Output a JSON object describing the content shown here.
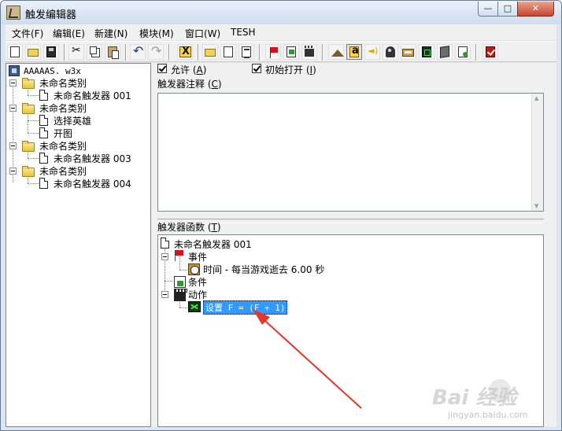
{
  "window": {
    "title": "触发编辑器",
    "controls": {
      "minimize": "—",
      "maximize": "□",
      "close": "✕"
    }
  },
  "menubar": {
    "items": [
      {
        "label": "文件(F)"
      },
      {
        "label": "编辑(E)"
      },
      {
        "label": "新建(N)"
      },
      {
        "label": "模块(M)"
      },
      {
        "label": "窗口(W)"
      },
      {
        "label": "TESH"
      }
    ]
  },
  "toolbar": {
    "icons": [
      "new-icon",
      "open-folder-icon",
      "save-icon",
      "cut-icon",
      "copy-icon",
      "paste-icon",
      "undo-icon",
      "redo-icon",
      "jass-x-icon",
      "new-category-icon",
      "new-trigger-icon",
      "new-comment-icon",
      "new-event-icon",
      "new-condition-icon",
      "new-action-icon",
      "terrain-editor-icon",
      "trigger-editor-icon",
      "sound-editor-icon",
      "object-editor-icon",
      "campaign-editor-icon",
      "ai-editor-icon",
      "object-manager-icon",
      "import-manager-icon",
      "test-map-icon"
    ],
    "pressed": "trigger-editor-icon"
  },
  "left_tree": {
    "root": "AAAAAS. w3x",
    "categories": [
      {
        "label": "未命名类别",
        "triggers": [
          "未命名触发器 001"
        ]
      },
      {
        "label": "未命名类别",
        "triggers": [
          "选择英雄",
          "开图"
        ]
      },
      {
        "label": "未命名类别",
        "triggers": [
          "未命名触发器 003"
        ]
      },
      {
        "label": "未命名类别",
        "triggers": [
          "未命名触发器 004"
        ]
      }
    ]
  },
  "trigger_options": {
    "enabled_label": "允许",
    "enabled_hotkey": "A",
    "enabled_checked": true,
    "initially_on_label": "初始打开",
    "initially_on_hotkey": "I",
    "initially_on_checked": true
  },
  "comment": {
    "label": "触发器注释",
    "hotkey": "C",
    "value": ""
  },
  "functions": {
    "label": "触发器函数",
    "hotkey": "T",
    "trigger_name": "未命名触发器 001",
    "events_label": "事件",
    "event_item": "时间 - 每当游戏逝去 6.00 秒",
    "conditions_label": "条件",
    "actions_label": "动作",
    "action_item": "设置 F = (F + 1)"
  },
  "annotation": {
    "arrow_color": "#e8352a"
  },
  "watermark": {
    "brand": "Bai 经验",
    "url": "jingyan.baidu.com"
  },
  "colors": {
    "selection": "#3399ff",
    "frame": "#dbe6f3",
    "face": "#f0f0f0"
  }
}
